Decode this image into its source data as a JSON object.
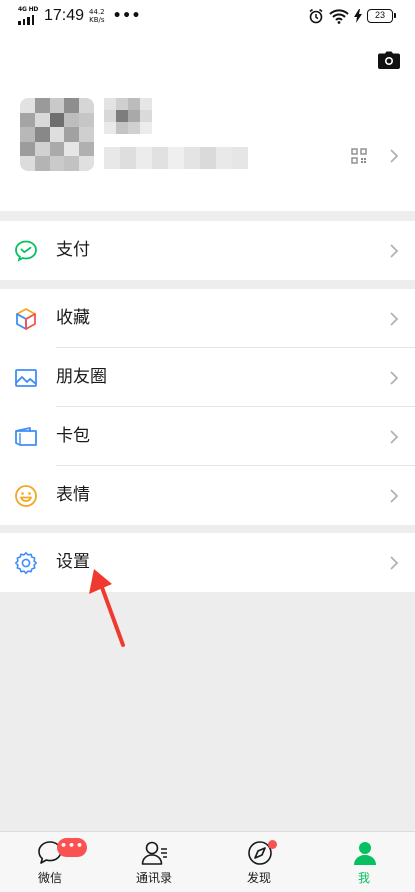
{
  "status_bar": {
    "network": "4G HD",
    "time": "17:49",
    "speed_value": "44.2",
    "speed_unit": "KB/s",
    "more": "•••",
    "battery": "23"
  },
  "profile": {
    "camera_icon": "camera-icon",
    "qr_icon": "qr-code-icon"
  },
  "menu": {
    "pay": {
      "label": "支付",
      "icon": "wechat-pay-icon"
    },
    "favorites": {
      "label": "收藏",
      "icon": "favorites-cube-icon"
    },
    "moments": {
      "label": "朋友圈",
      "icon": "moments-picture-icon"
    },
    "cards": {
      "label": "卡包",
      "icon": "wallet-card-icon"
    },
    "stickers": {
      "label": "表情",
      "icon": "smiley-icon"
    },
    "settings": {
      "label": "设置",
      "icon": "gear-icon"
    }
  },
  "tabbar": {
    "chats": {
      "label": "微信",
      "badge": "•••"
    },
    "contacts": {
      "label": "通讯录"
    },
    "discover": {
      "label": "发现"
    },
    "me": {
      "label": "我"
    }
  },
  "colors": {
    "accent": "#07c160",
    "badge": "#fa5151",
    "background": "#ededed",
    "annotation_arrow": "#f03a2f"
  }
}
